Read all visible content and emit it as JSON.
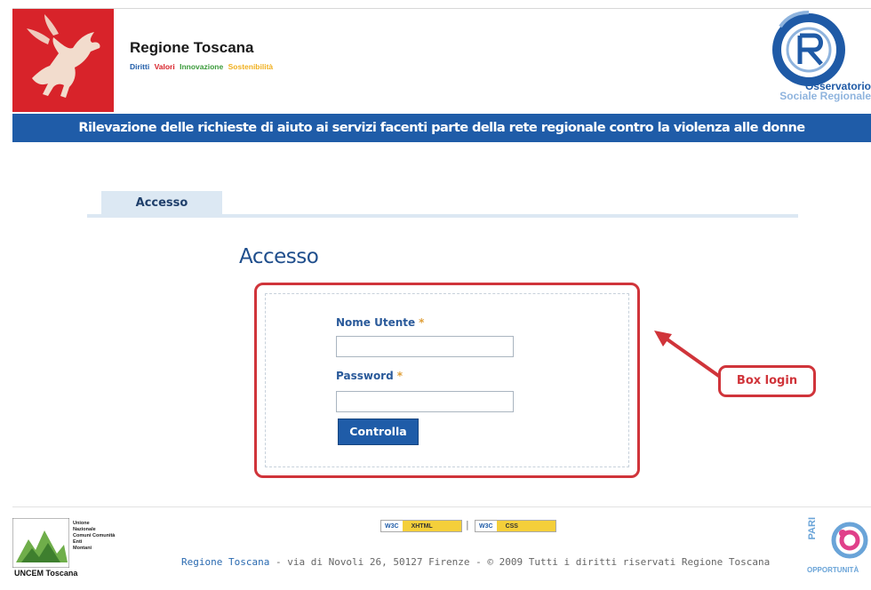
{
  "header": {
    "brand_title": "Regione Toscana",
    "tagline": [
      {
        "word": "Diritti",
        "color": "#1f5ca8"
      },
      {
        "word": "Valori",
        "color": "#d8232a"
      },
      {
        "word": "Innovazione",
        "color": "#3a9a3a"
      },
      {
        "word": "Sostenibilità",
        "color": "#f0b020"
      }
    ],
    "osr_line1": "Osservatorio",
    "osr_line2": "Sociale Regionale",
    "banner": "Rilevazione delle richieste di aiuto ai servizi facenti parte della rete regionale contro la violenza alle donne"
  },
  "tabs": [
    {
      "label": "Accesso"
    }
  ],
  "main": {
    "title": "Accesso",
    "username_label": "Nome Utente",
    "password_label": "Password",
    "required_mark": "*",
    "submit_label": "Controlla",
    "username_value": "",
    "password_value": ""
  },
  "annotation": {
    "callout": "Box login",
    "color": "#d0343a"
  },
  "footer": {
    "uncem_lines": [
      "Unione",
      "Nazionale",
      "Comuni Comunità",
      "Enti",
      "Montani"
    ],
    "uncem_name": "UNCEM Toscana",
    "badge_w3c": "W3C",
    "badge_xhtml": "XHTML",
    "badge_css": "CSS",
    "separator": "|",
    "link_text": "Regione Toscana",
    "address": " - via di Novoli 26, 50127 Firenze - © 2009 Tutti i diritti riservati Regione Toscana",
    "pari_line1": "PARI",
    "pari_line2": "OPPORTUNITÀ"
  },
  "colors": {
    "brand_red": "#d8232a",
    "brand_blue": "#1f5ca8",
    "tab_bg": "#dce8f3"
  }
}
